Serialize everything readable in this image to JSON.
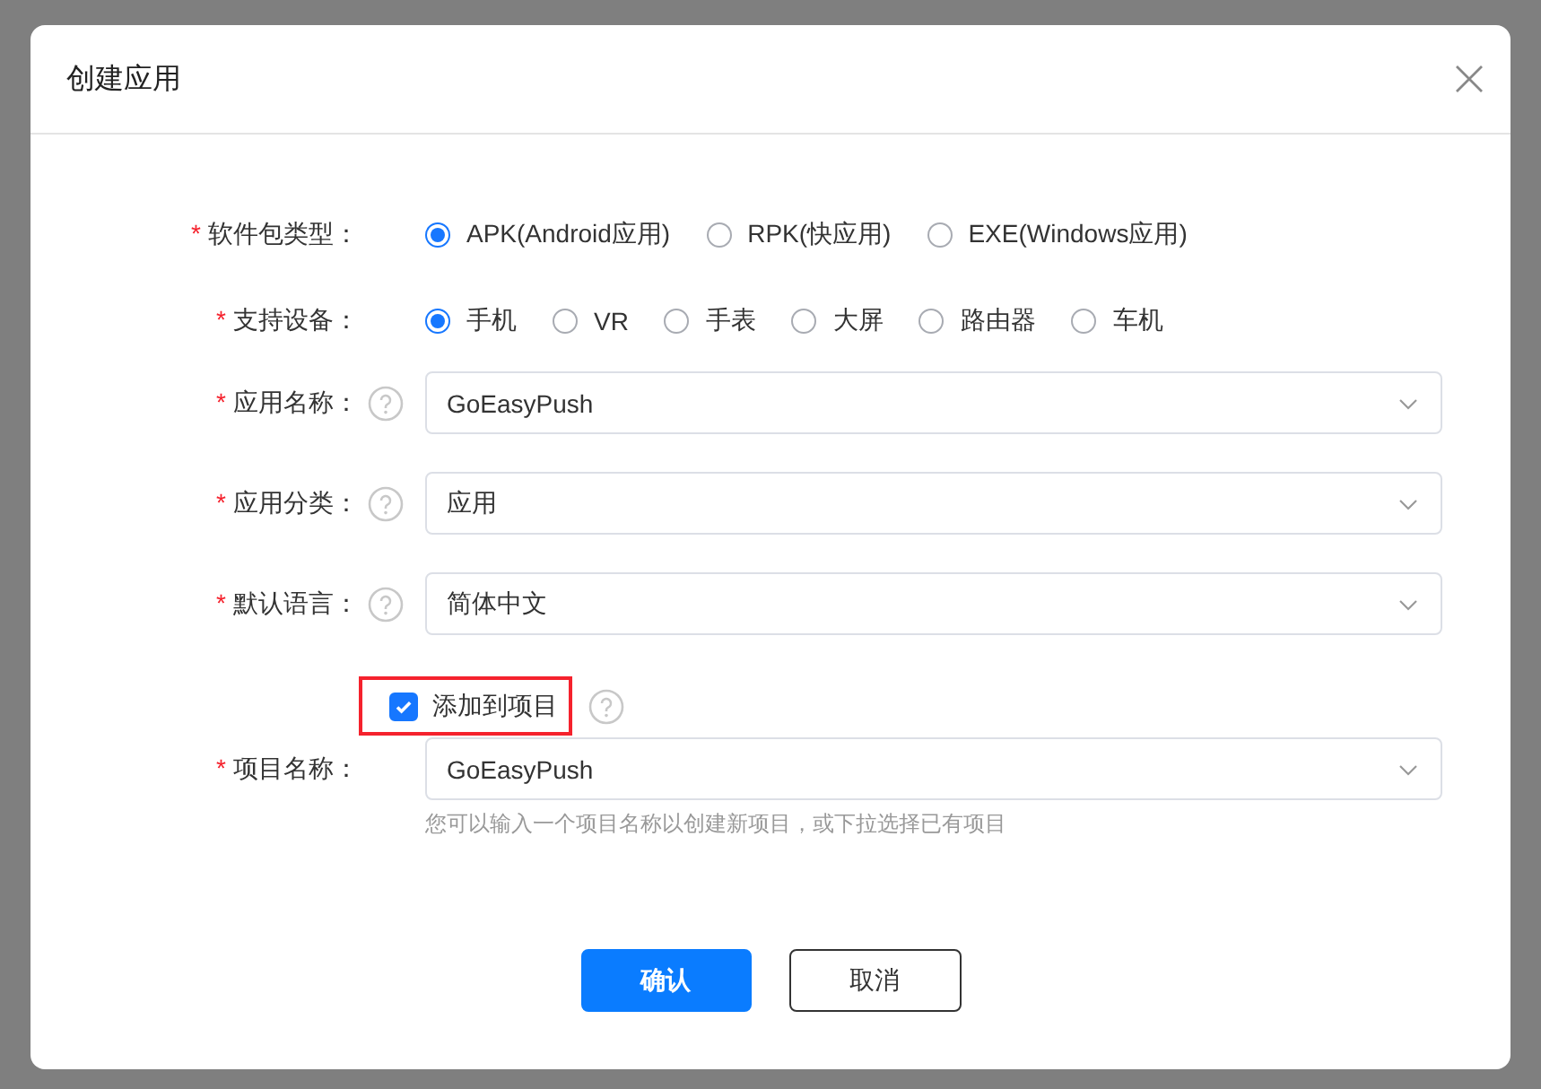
{
  "dialog": {
    "title": "创建应用",
    "fields": [
      {
        "kind": "radio",
        "label": "软件包类型：",
        "mark": "*",
        "options": [
          {
            "label": "APK(Android应用)",
            "selected": true
          },
          {
            "label": "RPK(快应用)",
            "selected": false
          },
          {
            "label": "EXE(Windows应用)",
            "selected": false
          }
        ]
      },
      {
        "kind": "radio",
        "label": "支持设备：",
        "mark": "*",
        "options": [
          {
            "label": "手机",
            "selected": true
          },
          {
            "label": "VR",
            "selected": false
          },
          {
            "label": "手表",
            "selected": false
          },
          {
            "label": "大屏",
            "selected": false
          },
          {
            "label": "路由器",
            "selected": false
          },
          {
            "label": "车机",
            "selected": false
          }
        ]
      },
      {
        "kind": "select",
        "label": "应用名称：",
        "mark": "*",
        "help": true,
        "value": "GoEasyPush"
      },
      {
        "kind": "select",
        "label": "应用分类：",
        "mark": "*",
        "help": true,
        "value": "应用"
      },
      {
        "kind": "select",
        "label": "默认语言：",
        "mark": "*",
        "help": true,
        "value": "简体中文"
      },
      {
        "kind": "checkbox",
        "label": "添加到项目",
        "checked": true,
        "highlighted": true,
        "help": true
      },
      {
        "kind": "select",
        "label": "项目名称：",
        "mark": "*",
        "help": false,
        "value": "GoEasyPush",
        "hint": "您可以输入一个项目名称以创建新项目，或下拉选择已有项目"
      }
    ],
    "buttons": [
      {
        "label": "确认",
        "kind": "primary"
      },
      {
        "label": "取消",
        "kind": "default"
      }
    ]
  }
}
